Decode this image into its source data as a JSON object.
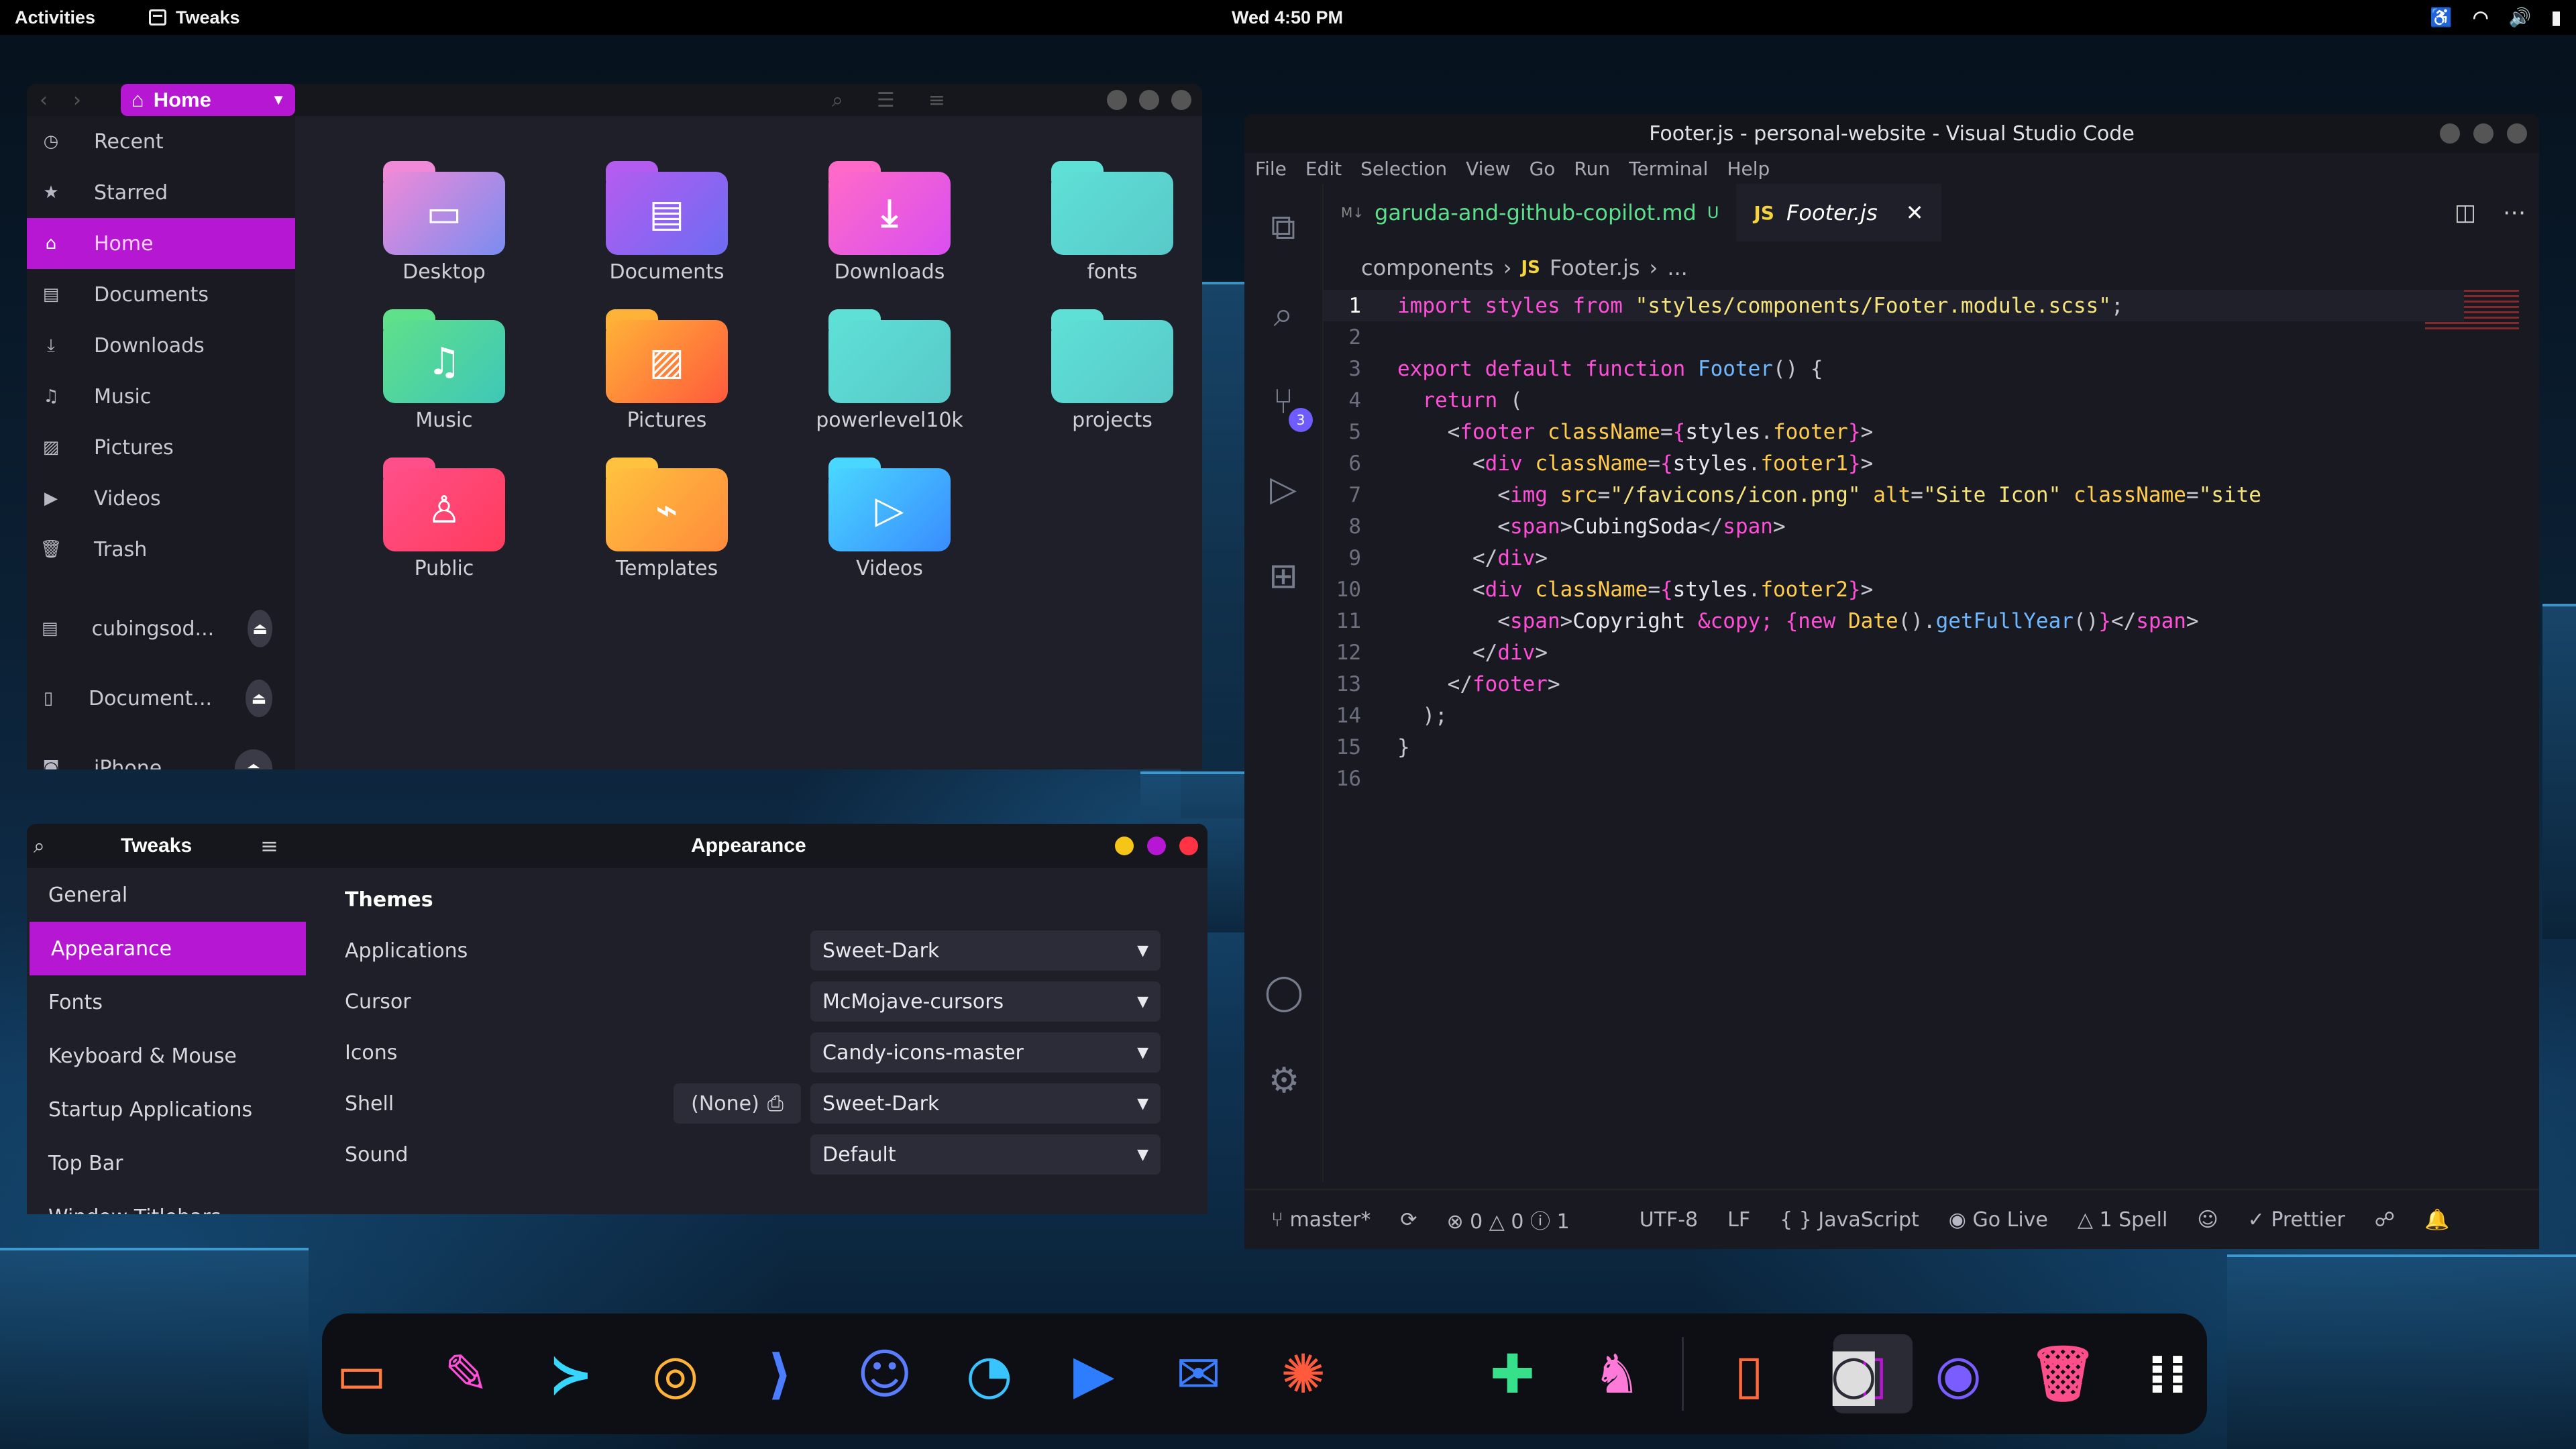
{
  "topbar": {
    "activities": "Activities",
    "app_name": "Tweaks",
    "clock": "Wed 4:50 PM"
  },
  "files": {
    "path_label": "Home",
    "sidebar": [
      {
        "label": "Recent",
        "icon": "clock-icon"
      },
      {
        "label": "Starred",
        "icon": "star-icon"
      },
      {
        "label": "Home",
        "icon": "home-icon",
        "active": true
      },
      {
        "label": "Documents",
        "icon": "document-icon"
      },
      {
        "label": "Downloads",
        "icon": "download-icon"
      },
      {
        "label": "Music",
        "icon": "music-icon"
      },
      {
        "label": "Pictures",
        "icon": "picture-icon"
      },
      {
        "label": "Videos",
        "icon": "video-icon"
      },
      {
        "label": "Trash",
        "icon": "trash-icon"
      }
    ],
    "devices": [
      {
        "label": "cubingsod...",
        "icon": "drive-icon"
      },
      {
        "label": "Document...",
        "icon": "phone-icon"
      },
      {
        "label": "iPhone",
        "icon": "camera-icon"
      }
    ],
    "folders": [
      {
        "label": "Desktop",
        "color1": "#f08ad8",
        "color2": "#7a8cf0",
        "glyph": "▭"
      },
      {
        "label": "Documents",
        "color1": "#b45cf0",
        "color2": "#6d6cf2",
        "glyph": "▤"
      },
      {
        "label": "Downloads",
        "color1": "#ff6ac8",
        "color2": "#d94ff0",
        "glyph": "⤓"
      },
      {
        "label": "fonts",
        "color1": "#5ee0d6",
        "color2": "#58c9c9",
        "glyph": ""
      },
      {
        "label": "Music",
        "color1": "#5fe08a",
        "color2": "#3fc7b8",
        "glyph": "♫"
      },
      {
        "label": "Pictures",
        "color1": "#ffb238",
        "color2": "#ff5a3c",
        "glyph": "▨"
      },
      {
        "label": "powerlevel10k",
        "color1": "#5ee0d6",
        "color2": "#58c9c9",
        "glyph": ""
      },
      {
        "label": "projects",
        "color1": "#5ee0d6",
        "color2": "#58c9c9",
        "glyph": ""
      },
      {
        "label": "Public",
        "color1": "#ff4f8a",
        "color2": "#ff3c5c",
        "glyph": "♙"
      },
      {
        "label": "Templates",
        "color1": "#ffc23e",
        "color2": "#ff8a3c",
        "glyph": "⌁"
      },
      {
        "label": "Videos",
        "color1": "#49d6ff",
        "color2": "#3a8cff",
        "glyph": "▷"
      }
    ]
  },
  "tweaks": {
    "title": "Tweaks",
    "panel_title": "Appearance",
    "nav": [
      "General",
      "Appearance",
      "Fonts",
      "Keyboard & Mouse",
      "Startup Applications",
      "Top Bar",
      "Window Titlebars"
    ],
    "section": "Themes",
    "rows": [
      {
        "label": "Applications",
        "value": "Sweet-Dark"
      },
      {
        "label": "Cursor",
        "value": "McMojave-cursors"
      },
      {
        "label": "Icons",
        "value": "Candy-icons-master"
      },
      {
        "label": "Shell",
        "value": "Sweet-Dark",
        "extra": "(None)"
      },
      {
        "label": "Sound",
        "value": "Default"
      }
    ],
    "dot_colors": [
      "#f5c518",
      "#b617d3",
      "#ff3344"
    ]
  },
  "vscode": {
    "title": "Footer.js - personal-website - Visual Studio Code",
    "menu": [
      "File",
      "Edit",
      "Selection",
      "View",
      "Go",
      "Run",
      "Terminal",
      "Help"
    ],
    "tab_md": "garuda-and-github-copilot.md",
    "tab_md_status": "U",
    "tab_md_badge": "M↓",
    "tab_js": "Footer.js",
    "js_badge": "JS",
    "breadcrumb_folder": "components",
    "breadcrumb_file": "Footer.js",
    "breadcrumb_more": "...",
    "scm_badge": "3",
    "status": {
      "branch": "master*",
      "errors": "0",
      "warnings": "0",
      "info": "1",
      "encoding": "UTF-8",
      "eol": "LF",
      "language": "JavaScript",
      "golive": "Go Live",
      "spell": "1 Spell",
      "prettier": "Prettier"
    }
  },
  "dock": [
    "files-icon",
    "editor-icon",
    "terminal-icon",
    "chrome-icon",
    "vscode-icon",
    "discord-icon",
    "edge-icon",
    "zoom-icon",
    "mail-icon",
    "aperture-icon",
    "switch-icon",
    "extensions-icon",
    "gimp-icon",
    "tablet-icon",
    "camera-icon",
    "disk-icon",
    "trash-icon",
    "app-grid-icon"
  ]
}
